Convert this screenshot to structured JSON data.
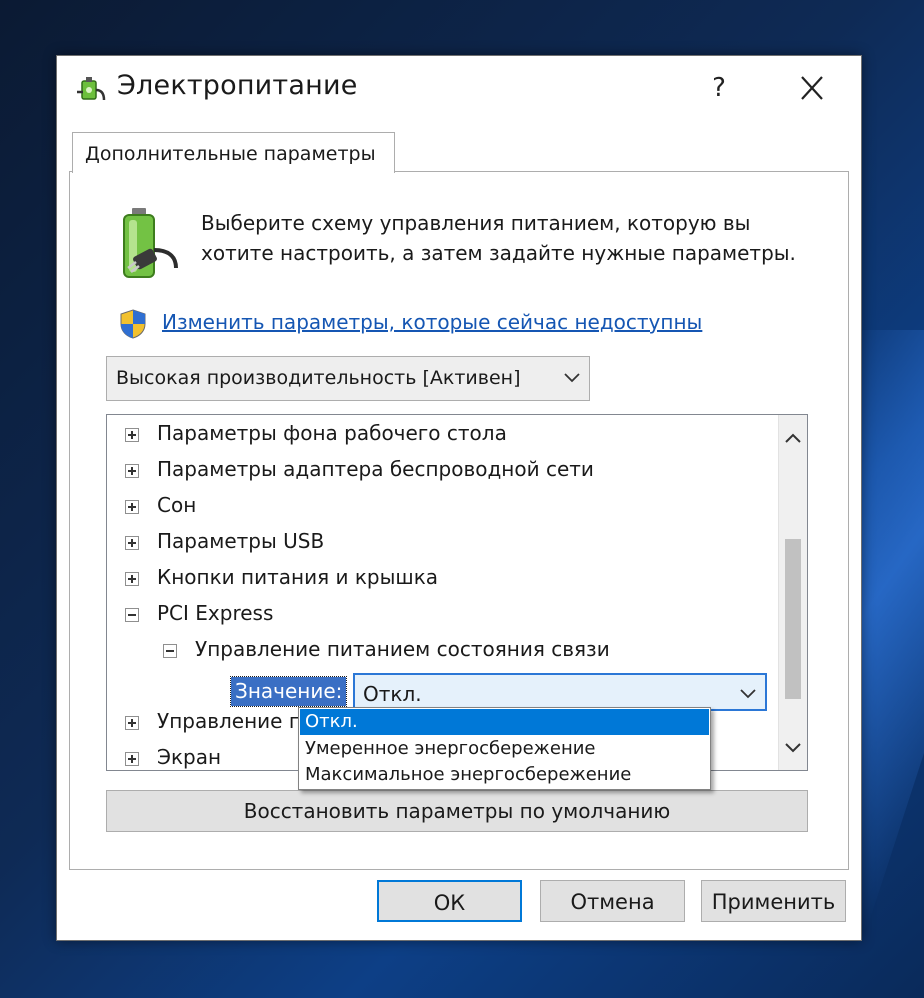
{
  "window": {
    "title": "Электропитание",
    "help_label": "?",
    "icon": "power-plug-icon"
  },
  "tab": {
    "label": "Дополнительные параметры"
  },
  "intro": {
    "text": "Выберите схему управления питанием, которую вы хотите настроить, а затем задайте нужные параметры."
  },
  "link": {
    "text": "Изменить параметры, которые сейчас недоступны"
  },
  "plan_select": {
    "value": "Высокая производительность [Активен]"
  },
  "tree": {
    "items": [
      {
        "label": "Параметры фона рабочего стола",
        "state": "collapsed",
        "level": 0
      },
      {
        "label": "Параметры адаптера беспроводной сети",
        "state": "collapsed",
        "level": 0
      },
      {
        "label": "Сон",
        "state": "collapsed",
        "level": 0
      },
      {
        "label": "Параметры USB",
        "state": "collapsed",
        "level": 0
      },
      {
        "label": "Кнопки питания и крышка",
        "state": "collapsed",
        "level": 0
      },
      {
        "label": "PCI Express",
        "state": "expanded",
        "level": 0
      },
      {
        "label": "Управление питанием состояния связи",
        "state": "expanded",
        "level": 1
      },
      {
        "label": "Управление питан",
        "state": "collapsed",
        "level": 0
      },
      {
        "label": "Экран",
        "state": "collapsed",
        "level": 0
      }
    ],
    "value_label": "Значение:",
    "value_current": "Откл."
  },
  "dropdown": {
    "options": [
      {
        "label": "Откл.",
        "selected": true
      },
      {
        "label": "Умеренное энергосбережение",
        "selected": false
      },
      {
        "label": "Максимальное энергосбережение",
        "selected": false
      }
    ]
  },
  "buttons": {
    "restore": "Восстановить параметры по умолчанию",
    "ok": "ОК",
    "cancel": "Отмена",
    "apply": "Применить"
  },
  "colors": {
    "accent": "#0078d7",
    "link": "#1556b3",
    "selection": "#3a6fc4"
  }
}
